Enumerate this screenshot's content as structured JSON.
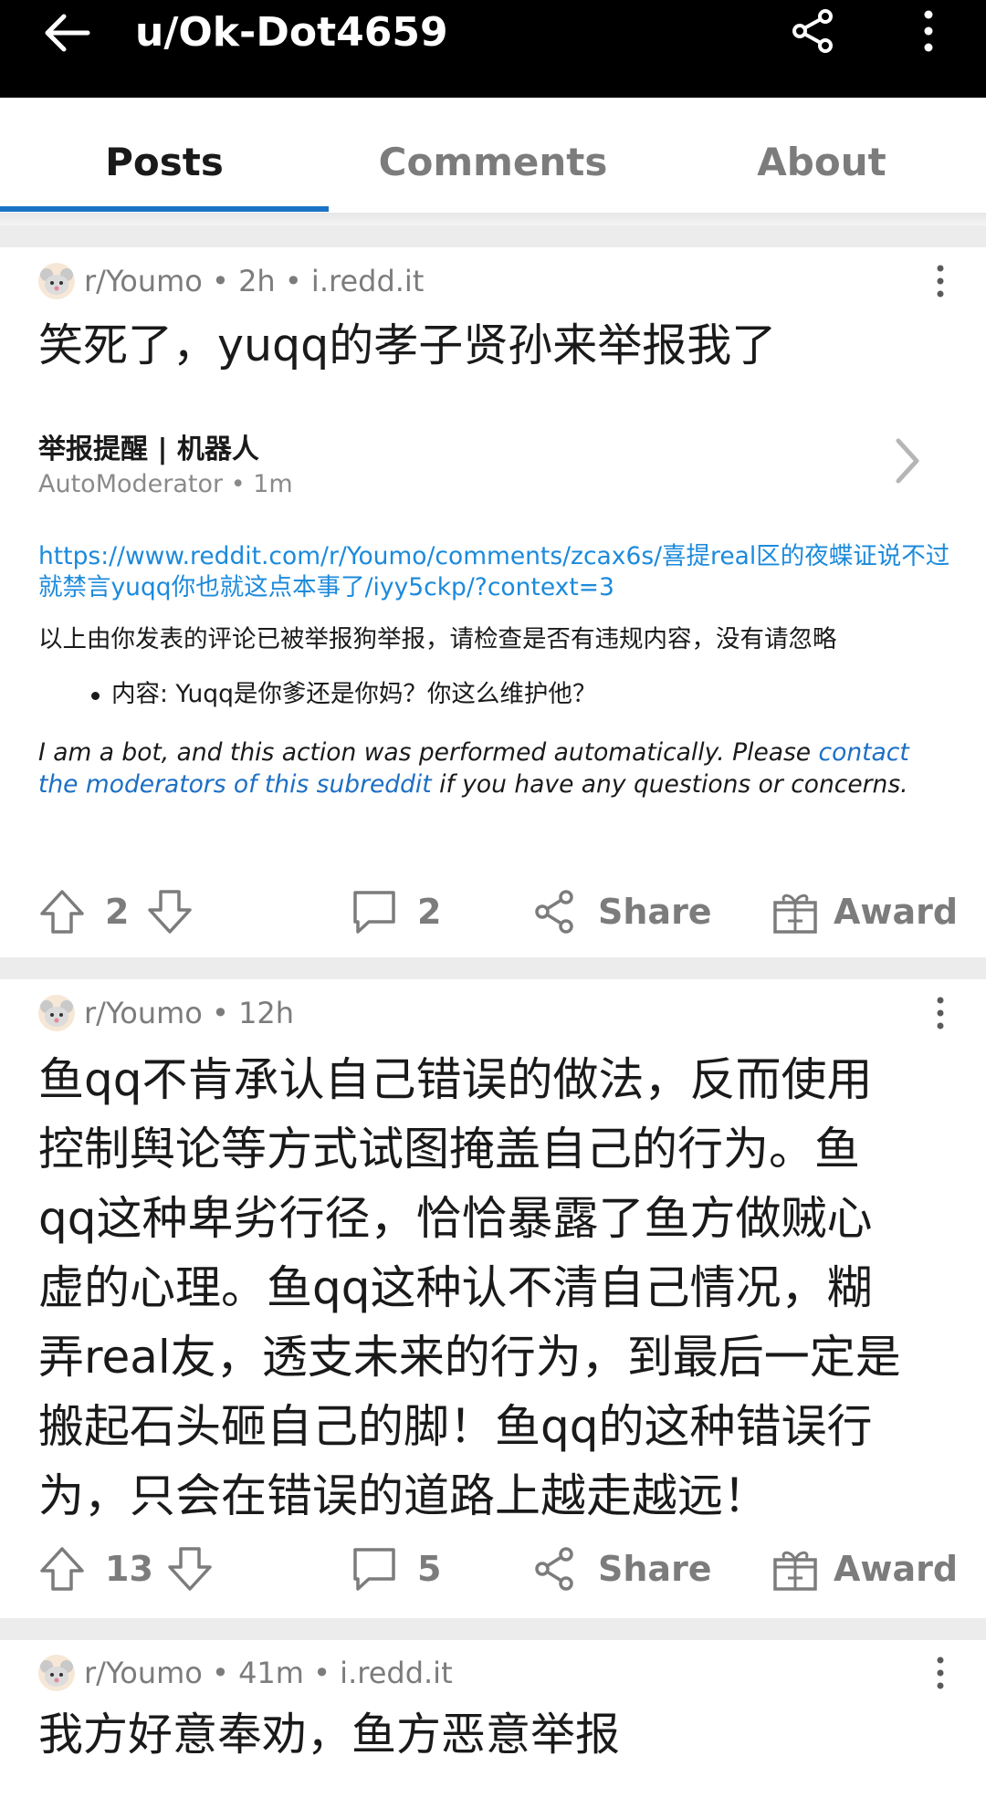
{
  "header": {
    "title": "u/Ok-Dot4659"
  },
  "tabs": [
    "Posts",
    "Comments",
    "About"
  ],
  "posts": [
    {
      "subreddit": "r/Youmo",
      "time": "2h",
      "domain": "i.redd.it",
      "title": "笑死了，yuqq的孝子贤孙来举报我了",
      "embed": {
        "title": "举报提醒 | 机器人",
        "author": "AutoModerator",
        "time": "1m",
        "link": "https://www.reddit.com/r/Youmo/comments/zcax6s/喜提real区的夜蝶证说不过就禁言yuqq你也就这点本事了/iyy5ckp/?context=3",
        "notice": "以上由你发表的评论已被举报狗举报，请检查是否有违规内容，没有请忽略",
        "bullet": "内容: Yuqq是你爹还是你妈？你这么维护他？",
        "bot_text_1": "I am a bot, and this action was performed automatically. Please ",
        "bot_link": "contact the moderators of this subreddit",
        "bot_text_2": " if you have any questions or concerns."
      },
      "votes": "2",
      "comments": "2",
      "share_label": "Share",
      "award_label": "Award"
    },
    {
      "subreddit": "r/Youmo",
      "time": "12h",
      "title_lines": [
        "鱼qq不肯承认自己错误的做法，反而使用",
        "控制舆论等方式试图掩盖自己的行为。鱼",
        "qq这种卑劣行径，恰恰暴露了鱼方做贼心",
        "虚的心理。鱼qq这种认不清自己情况，糊",
        "弄real友，透支未来的行为，到最后一定是",
        "搬起石头砸自己的脚！鱼qq的这种错误行",
        "为，只会在错误的道路上越走越远！"
      ],
      "votes": "13",
      "comments": "5",
      "share_label": "Share",
      "award_label": "Award"
    },
    {
      "subreddit": "r/Youmo",
      "time": "41m",
      "domain": "i.redd.it",
      "title": "我方好意奉劝，鱼方恶意举报"
    }
  ],
  "colors": {
    "accent": "#1a73c4",
    "link": "#1c8adb",
    "muted": "#7c7c7c"
  }
}
